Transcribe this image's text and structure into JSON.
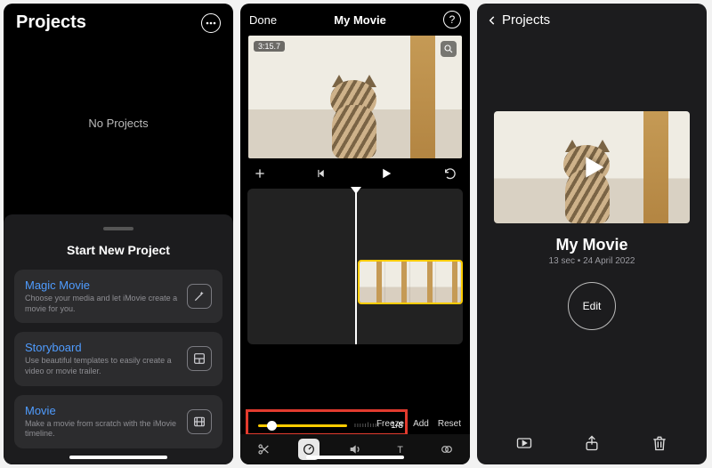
{
  "p1": {
    "title": "Projects",
    "empty": "No Projects",
    "sheet_title": "Start New Project",
    "options": [
      {
        "name": "Magic Movie",
        "sub": "Choose your media and let iMovie create a movie for you.",
        "icon": "wand-sparkles-icon"
      },
      {
        "name": "Storyboard",
        "sub": "Use beautiful templates to easily create a video or movie trailer.",
        "icon": "layout-panel-icon"
      },
      {
        "name": "Movie",
        "sub": "Make a movie from scratch with the iMovie timeline.",
        "icon": "film-icon"
      }
    ]
  },
  "p2": {
    "done": "Done",
    "title": "My Movie",
    "clip_time": "3:15.7",
    "speed_value": "1/8",
    "speed_actions": {
      "freeze": "Freeze",
      "add": "Add",
      "reset": "Reset"
    },
    "title_badge": "T"
  },
  "p3": {
    "back": "Projects",
    "movie_title": "My Movie",
    "meta": "13 sec • 24 April 2022",
    "edit": "Edit"
  }
}
